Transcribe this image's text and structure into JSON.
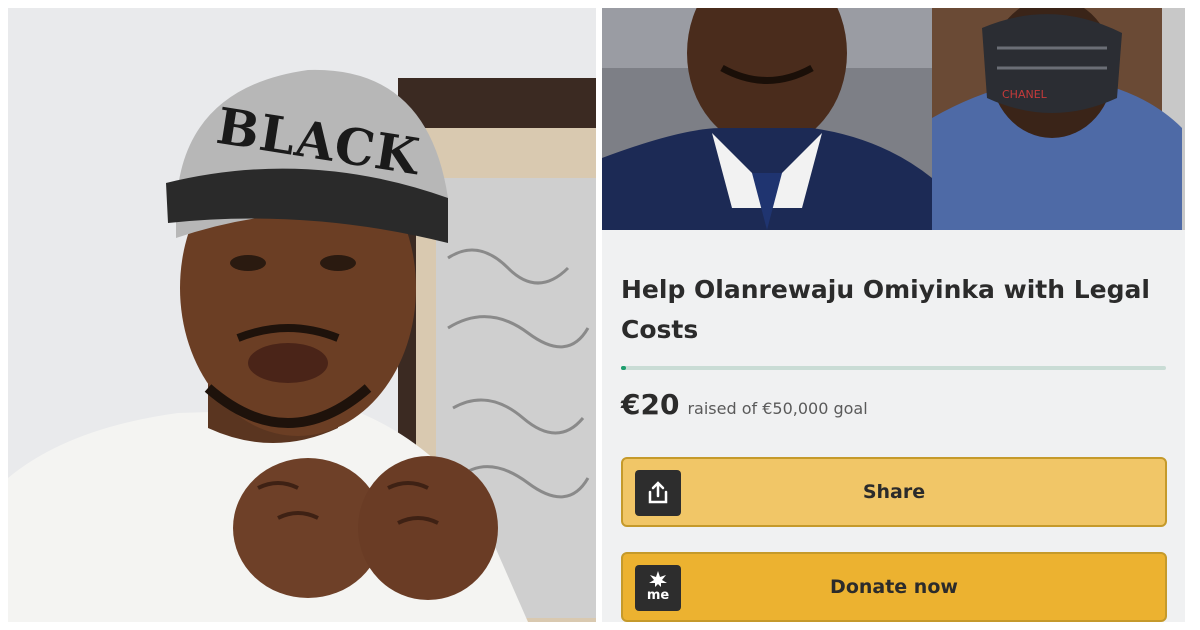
{
  "left_photo": {
    "cap_text": "BLACK"
  },
  "campaign": {
    "title": "Help Olanrewaju Omiyinka with Legal Costs",
    "amount_raised": "€20",
    "goal_text": "raised of €50,000 goal",
    "progress_fraction": 0.0004,
    "share_label": "Share",
    "donate_label": "Donate now",
    "share_icon": "share-upload-icon",
    "donate_icon": "gofundme-me-icon",
    "donate_icon_text": "me"
  },
  "colors": {
    "progress_fill": "#1e9e6e",
    "share_button": "#f1c667",
    "donate_button": "#ecb230",
    "button_border": "#c59a2b"
  },
  "photo_strip": {
    "mask_text": "CHANEL"
  }
}
